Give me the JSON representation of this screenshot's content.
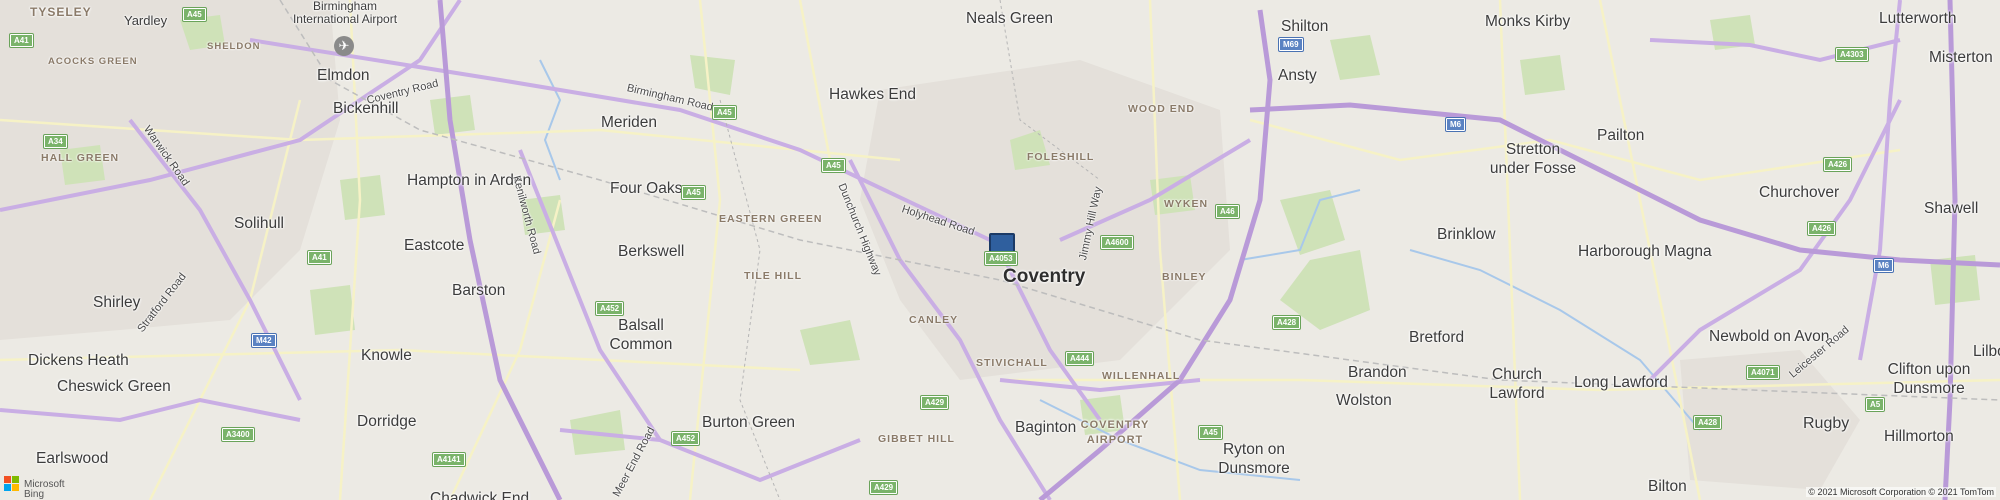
{
  "map": {
    "colors": {
      "land": "#eceae4",
      "green": "#cfe2b8",
      "water": "#a8c8ea",
      "motorway": "#b99ad8",
      "primary_road": "#c9aee4",
      "minor_road": "#f6f2c6",
      "urban": "#e4e0da",
      "marker": "#2f5f9e"
    },
    "marker": {
      "name": "location-marker",
      "shield": "A4053"
    },
    "places": [
      {
        "name": "Tyseley"
      },
      {
        "name": "Yardley"
      },
      {
        "name": "Acocks Green"
      },
      {
        "name": "Sheldon"
      },
      {
        "name": "Birmingham International Airport"
      },
      {
        "name": "Elmdon"
      },
      {
        "name": "Bickenhill"
      },
      {
        "name": "Hall Green"
      },
      {
        "name": "Solihull"
      },
      {
        "name": "Shirley"
      },
      {
        "name": "Dickens Heath"
      },
      {
        "name": "Cheswick Green"
      },
      {
        "name": "Earlswood"
      },
      {
        "name": "Hampton in Arden"
      },
      {
        "name": "Eastcote"
      },
      {
        "name": "Barston"
      },
      {
        "name": "Knowle"
      },
      {
        "name": "Dorridge"
      },
      {
        "name": "Meriden"
      },
      {
        "name": "Four Oaks"
      },
      {
        "name": "Berkswell"
      },
      {
        "name": "Balsall Common"
      },
      {
        "name": "Burton Green"
      },
      {
        "name": "Hawkes End"
      },
      {
        "name": "Neals Green"
      },
      {
        "name": "Eastern Green"
      },
      {
        "name": "Tile Hill"
      },
      {
        "name": "Canley"
      },
      {
        "name": "Foleshill"
      },
      {
        "name": "Coventry"
      },
      {
        "name": "Stivichall"
      },
      {
        "name": "Gibbet Hill"
      },
      {
        "name": "Baginton"
      },
      {
        "name": "Coventry Airport"
      },
      {
        "name": "Willenhall"
      },
      {
        "name": "Binley"
      },
      {
        "name": "Wyken"
      },
      {
        "name": "Wood End"
      },
      {
        "name": "Shilton"
      },
      {
        "name": "Ansty"
      },
      {
        "name": "Ryton on Dunsmore"
      },
      {
        "name": "Wolston"
      },
      {
        "name": "Brandon"
      },
      {
        "name": "Bretford"
      },
      {
        "name": "Brinklow"
      },
      {
        "name": "Stretton under Fosse"
      },
      {
        "name": "Monks Kirby"
      },
      {
        "name": "Pailton"
      },
      {
        "name": "Church Lawford"
      },
      {
        "name": "Long Lawford"
      },
      {
        "name": "Harborough Magna"
      },
      {
        "name": "Churchover"
      },
      {
        "name": "Newbold on Avon"
      },
      {
        "name": "Lutterworth"
      },
      {
        "name": "Misterton"
      },
      {
        "name": "Shawell"
      },
      {
        "name": "Clifton upon Dunsmore"
      },
      {
        "name": "Lilbo"
      },
      {
        "name": "Rugby"
      },
      {
        "name": "Hillmorton"
      },
      {
        "name": "Bilton"
      },
      {
        "name": "Chadwick End"
      }
    ],
    "roads": [
      {
        "name": "Coventry Road"
      },
      {
        "name": "Birmingham Road"
      },
      {
        "name": "Warwick Road"
      },
      {
        "name": "Kenilworth Road"
      },
      {
        "name": "Stratford Road"
      },
      {
        "name": "Holyhead Road"
      },
      {
        "name": "Dunchurch Highway"
      },
      {
        "name": "Jimmy Hill Way"
      },
      {
        "name": "Meer End Road"
      },
      {
        "name": "Leicester Road"
      }
    ],
    "shields": [
      {
        "label": "A45"
      },
      {
        "label": "A41"
      },
      {
        "label": "A34"
      },
      {
        "label": "A452"
      },
      {
        "label": "M42"
      },
      {
        "label": "A3400"
      },
      {
        "label": "A4141"
      },
      {
        "label": "A429"
      },
      {
        "label": "A444"
      },
      {
        "label": "A46"
      },
      {
        "label": "A4600"
      },
      {
        "label": "A428"
      },
      {
        "label": "M69"
      },
      {
        "label": "M6"
      },
      {
        "label": "A426"
      },
      {
        "label": "A4303"
      },
      {
        "label": "A4071"
      },
      {
        "label": "A5"
      }
    ],
    "attribution": {
      "logo_text_line1": "Microsoft",
      "logo_text_line2": "Bing",
      "copyright": "© 2021 Microsoft Corporation © 2021 TomTom"
    }
  }
}
